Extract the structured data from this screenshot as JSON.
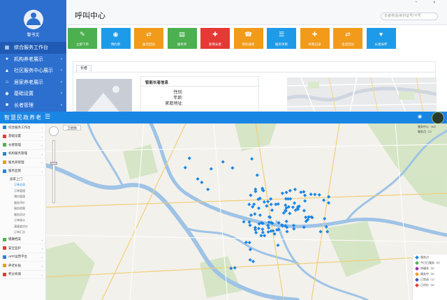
{
  "top": {
    "sidebar": {
      "username": "黎书文",
      "items": [
        {
          "label": "综合服务工作台",
          "icon": "dashboard-icon",
          "glyph": "▦",
          "chevron": ""
        },
        {
          "label": "机构养老展示",
          "icon": "building-icon",
          "glyph": "●",
          "chevron": "‹"
        },
        {
          "label": "社区服务中心展示",
          "icon": "community-icon",
          "glyph": "▲",
          "chevron": "‹"
        },
        {
          "label": "居家养老展示",
          "icon": "home-icon",
          "glyph": "⌂",
          "chevron": "‹"
        },
        {
          "label": "基础设置",
          "icon": "settings-icon",
          "glyph": "◆",
          "chevron": "‹"
        },
        {
          "label": "长者管理",
          "icon": "elder-icon",
          "glyph": "■",
          "chevron": "‹"
        }
      ]
    },
    "header": {
      "title": "呼叫中心",
      "search_placeholder": "长者电话/身份证号/卡号"
    },
    "actions": [
      {
        "label": "立即下单",
        "color": "#4caf50",
        "icon": "pencil-icon",
        "glyph": "✎"
      },
      {
        "label": "预约单",
        "color": "#1e9be8",
        "icon": "eye-icon",
        "glyph": "◉"
      },
      {
        "label": "服务回访",
        "color": "#f29a1a",
        "icon": "transfer-icon",
        "glyph": "⇄"
      },
      {
        "label": "服务单",
        "color": "#4caf50",
        "icon": "document-icon",
        "glyph": "▤"
      },
      {
        "label": "新增长者",
        "color": "#e53935",
        "icon": "gift-icon",
        "glyph": "✚"
      },
      {
        "label": "我的通话",
        "color": "#f29a1a",
        "icon": "group-icon",
        "glyph": "☎"
      },
      {
        "label": "服务项目",
        "color": "#1e9be8",
        "icon": "list-icon",
        "glyph": "☰"
      },
      {
        "label": "呼救记录",
        "color": "#f29a1a",
        "icon": "ambulance-icon",
        "glyph": "✚"
      },
      {
        "label": "电话回访",
        "color": "#f29a1a",
        "icon": "swap-icon",
        "glyph": "⇄"
      },
      {
        "label": "长者关怀",
        "color": "#1e9be8",
        "icon": "heart-icon",
        "glyph": "♥"
      }
    ],
    "panel": {
      "tab": "长者",
      "info_title": "智能长者信息",
      "fields": [
        "性别:",
        "年龄:",
        "家庭地址:"
      ]
    }
  },
  "bottom": {
    "header": {
      "logo": "智慧民政养老"
    },
    "sidebar": {
      "items": [
        {
          "label": "综合服务工作台",
          "color": "#1a86e4"
        },
        {
          "label": "基础设置",
          "color": "#e53935"
        },
        {
          "label": "长者管理",
          "color": "#4caf50"
        },
        {
          "label": "机构服务管理",
          "color": "#1a86e4"
        },
        {
          "label": "服务商管理",
          "color": "#f29a1a"
        },
        {
          "label": "服务监管",
          "color": "#1a86e4"
        }
      ],
      "parent": "居家上门",
      "subs": [
        "订单全局",
        "订单管理",
        "预约管理",
        "服务评价",
        "服务地图",
        "服务回访",
        "订单统计",
        "满意度评价",
        "订单汇总"
      ],
      "lower": [
        {
          "label": "健康档案",
          "color": "#4caf50"
        },
        {
          "label": "安全监护",
          "color": "#e53935"
        },
        {
          "label": "APP运营平台",
          "color": "#1a86e4"
        },
        {
          "label": "养老补贴",
          "color": "#f29a1a"
        },
        {
          "label": "积分商城",
          "color": "#e53935"
        }
      ]
    },
    "map": {
      "type_label": "卫星图",
      "legend_top": [
        "服务中心（43）",
        "服务点（1）"
      ],
      "legend_bottom": [
        {
          "label": "服务点",
          "color": "#1a86e4"
        },
        {
          "label": "今日已服务（0）",
          "color": "#4caf50"
        },
        {
          "label": "待服务（0）",
          "color": "#9c27b0"
        },
        {
          "label": "服务中（0）",
          "color": "#f29a1a"
        },
        {
          "label": "已完成（1）",
          "color": "#3f51b5"
        },
        {
          "label": "已评价（0）",
          "color": "#e53935"
        }
      ],
      "marker_color": "#1a86e4"
    }
  }
}
